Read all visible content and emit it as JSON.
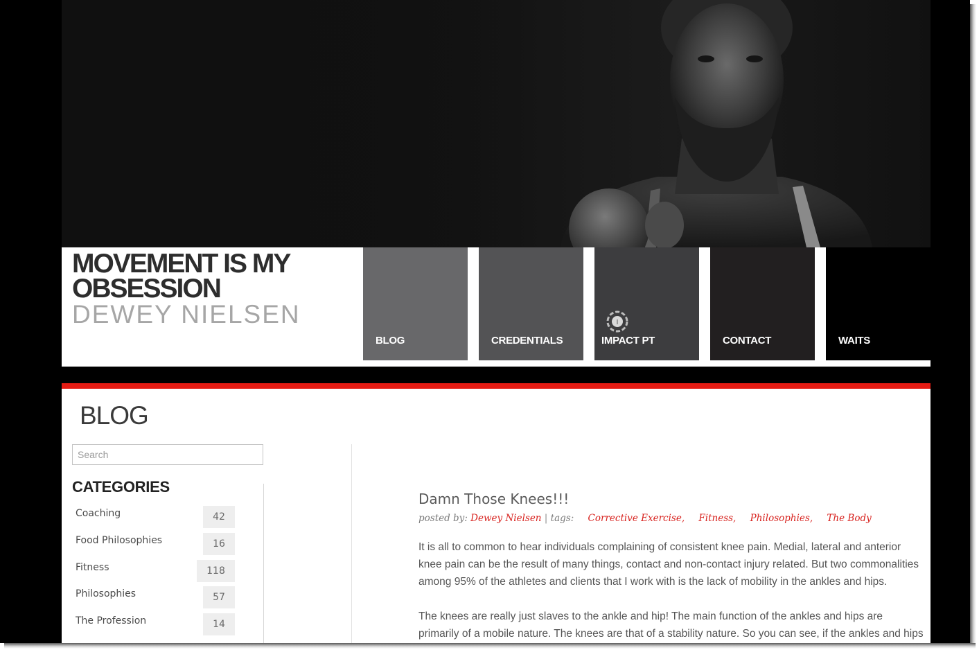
{
  "header": {
    "title_line1": "MOVEMENT IS MY",
    "title_line2": "OBSESSION",
    "subtitle": "DEWEY NIELSEN"
  },
  "nav": [
    {
      "label": "BLOG",
      "color": "#68686a"
    },
    {
      "label": "CREDENTIALS",
      "color": "#535355"
    },
    {
      "label": "IMPACT PT",
      "color": "#3d3d3f"
    },
    {
      "label": "CONTACT",
      "color": "#221f20"
    },
    {
      "label": "WAITS",
      "color": "#000000"
    }
  ],
  "page_heading": "BLOG",
  "search": {
    "placeholder": "Search",
    "value": ""
  },
  "categories": {
    "heading": "CATEGORIES",
    "items": [
      {
        "name": "Coaching",
        "count": "42"
      },
      {
        "name": "Food Philosophies",
        "count": "16"
      },
      {
        "name": "Fitness",
        "count": "118"
      },
      {
        "name": "Philosophies",
        "count": "57"
      },
      {
        "name": "The Profession",
        "count": "14"
      }
    ]
  },
  "post": {
    "title": "Damn Those Knees!!!",
    "posted_by_label": "posted by:",
    "author": "Dewey Nielsen",
    "tags_label": "tags:",
    "tags": [
      "Corrective Exercise,",
      "Fitness,",
      "Philosophies,",
      "The Body"
    ],
    "paragraphs": [
      "It is all to common to hear individuals complaining of consistent knee pain. Medial, lateral and anterior knee pain can be the result of many things, contact and non-contact injury related. But two commonalities among 95% of the athletes and clients that I work with is the lack of mobility in the ankles and hips.",
      "The knees are really just slaves to the ankle and hip! The main function of the ankles and hips are primarily of a mobile nature. The knees are that of a stability nature. So you can see, if the ankles and hips are stiff,"
    ]
  },
  "colors": {
    "accent": "#e41b13",
    "link": "#d8231f"
  }
}
